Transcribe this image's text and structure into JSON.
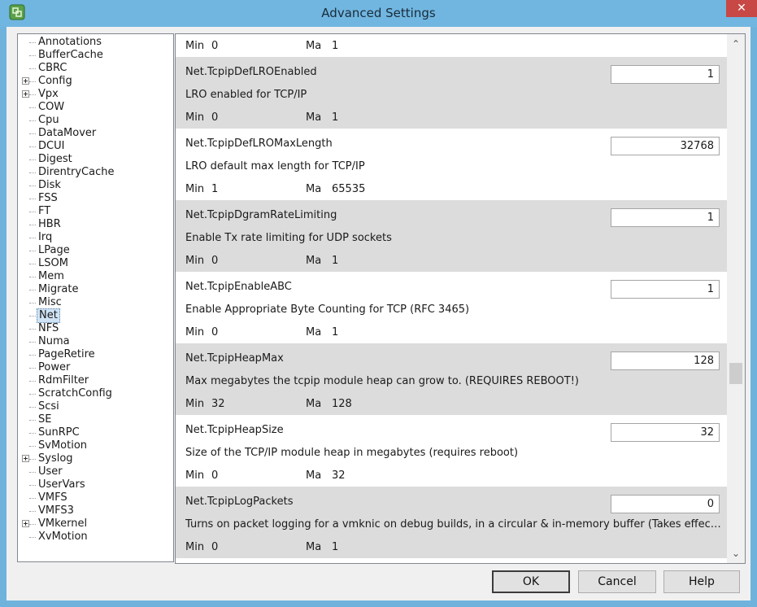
{
  "window": {
    "title": "Advanced Settings",
    "close_glyph": "✕"
  },
  "tree": {
    "items": [
      {
        "label": "Annotations",
        "expandable": false
      },
      {
        "label": "BufferCache",
        "expandable": false
      },
      {
        "label": "CBRC",
        "expandable": false
      },
      {
        "label": "Config",
        "expandable": true
      },
      {
        "label": "Vpx",
        "expandable": true
      },
      {
        "label": "COW",
        "expandable": false
      },
      {
        "label": "Cpu",
        "expandable": false
      },
      {
        "label": "DataMover",
        "expandable": false
      },
      {
        "label": "DCUI",
        "expandable": false
      },
      {
        "label": "Digest",
        "expandable": false
      },
      {
        "label": "DirentryCache",
        "expandable": false
      },
      {
        "label": "Disk",
        "expandable": false
      },
      {
        "label": "FSS",
        "expandable": false
      },
      {
        "label": "FT",
        "expandable": false
      },
      {
        "label": "HBR",
        "expandable": false
      },
      {
        "label": "Irq",
        "expandable": false
      },
      {
        "label": "LPage",
        "expandable": false
      },
      {
        "label": "LSOM",
        "expandable": false
      },
      {
        "label": "Mem",
        "expandable": false
      },
      {
        "label": "Migrate",
        "expandable": false
      },
      {
        "label": "Misc",
        "expandable": false
      },
      {
        "label": "Net",
        "expandable": false,
        "selected": true
      },
      {
        "label": "NFS",
        "expandable": false
      },
      {
        "label": "Numa",
        "expandable": false
      },
      {
        "label": "PageRetire",
        "expandable": false
      },
      {
        "label": "Power",
        "expandable": false
      },
      {
        "label": "RdmFilter",
        "expandable": false
      },
      {
        "label": "ScratchConfig",
        "expandable": false
      },
      {
        "label": "Scsi",
        "expandable": false
      },
      {
        "label": "SE",
        "expandable": false
      },
      {
        "label": "SunRPC",
        "expandable": false
      },
      {
        "label": "SvMotion",
        "expandable": false
      },
      {
        "label": "Syslog",
        "expandable": true
      },
      {
        "label": "User",
        "expandable": false
      },
      {
        "label": "UserVars",
        "expandable": false
      },
      {
        "label": "VMFS",
        "expandable": false
      },
      {
        "label": "VMFS3",
        "expandable": false
      },
      {
        "label": "VMkernel",
        "expandable": true
      },
      {
        "label": "XvMotion",
        "expandable": false
      }
    ]
  },
  "settings": {
    "min_label": "Min",
    "max_label": "Ma",
    "partial_top": {
      "min": "0",
      "max": "1"
    },
    "rows": [
      {
        "name": "Net.TcpipDefLROEnabled",
        "value": "1",
        "description": "LRO enabled for TCP/IP",
        "min": "0",
        "max": "1",
        "shaded": true
      },
      {
        "name": "Net.TcpipDefLROMaxLength",
        "value": "32768",
        "description": "LRO default max length for TCP/IP",
        "min": "1",
        "max": "65535",
        "shaded": false
      },
      {
        "name": "Net.TcpipDgramRateLimiting",
        "value": "1",
        "description": "Enable Tx rate limiting for UDP sockets",
        "min": "0",
        "max": "1",
        "shaded": true
      },
      {
        "name": "Net.TcpipEnableABC",
        "value": "1",
        "description": "Enable Appropriate Byte Counting for TCP (RFC 3465)",
        "min": "0",
        "max": "1",
        "shaded": false
      },
      {
        "name": "Net.TcpipHeapMax",
        "value": "128",
        "description": "Max megabytes the tcpip module heap can grow to. (REQUIRES REBOOT!)",
        "min": "32",
        "max": "128",
        "shaded": true
      },
      {
        "name": "Net.TcpipHeapSize",
        "value": "32",
        "description": "Size of the TCP/IP module heap in megabytes (requires reboot)",
        "min": "0",
        "max": "32",
        "shaded": false
      },
      {
        "name": "Net.TcpipLogPackets",
        "value": "0",
        "description": "Turns on packet logging for a vmknic on debug builds, in a circular & in-memory buffer (Takes effect du...",
        "min": "0",
        "max": "1",
        "shaded": true
      }
    ]
  },
  "scrollbar": {
    "up_glyph": "⌃",
    "down_glyph": "⌄"
  },
  "buttons": {
    "ok": "OK",
    "cancel": "Cancel",
    "help": "Help"
  }
}
